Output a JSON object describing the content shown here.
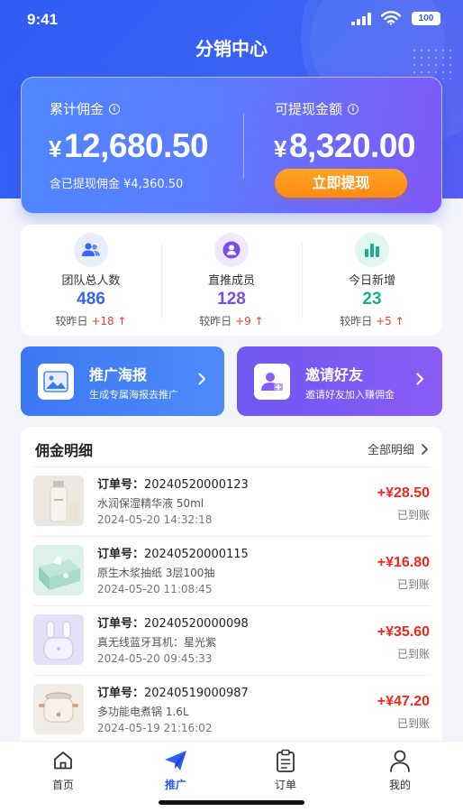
{
  "status_bar": {
    "time": "9:41",
    "battery": "100"
  },
  "page": {
    "title": "分销中心"
  },
  "commission": {
    "total_label": "累计佣金",
    "total_amount": "12,680.50",
    "currency": "¥",
    "withdrawn_text": "含已提现佣金 ¥4,360.50",
    "available_label": "可提现金额",
    "available_amount": "8,320.00",
    "withdraw_button": "立即提现"
  },
  "stats": [
    {
      "label": "团队总人数",
      "value": "486",
      "compare_label": "较昨日",
      "delta": "+18",
      "color": "#3a63f5"
    },
    {
      "label": "直推成员",
      "value": "128",
      "compare_label": "较昨日",
      "delta": "+9",
      "color": "#7b4de8"
    },
    {
      "label": "今日新增",
      "value": "23",
      "compare_label": "较昨日",
      "delta": "+5",
      "color": "#1eae8e"
    }
  ],
  "promo": {
    "poster_title": "推广海报",
    "poster_desc": "生成专属海报去推广",
    "invite_title": "邀请好友",
    "invite_desc": "邀请好友加入赚佣金"
  },
  "details": {
    "title": "佣金明细",
    "view_all": "全部明细",
    "items": [
      {
        "order_label": "订单号：",
        "order_no": "20240520000123",
        "product": "水润保湿精华液 50ml",
        "time": "2024-05-20 14:32:18",
        "amount": "+¥28.50",
        "status": "已到账"
      },
      {
        "order_label": "订单号：",
        "order_no": "20240520000115",
        "product": "原生木浆抽纸 3层100抽",
        "time": "2024-05-20 11:08:45",
        "amount": "+¥16.80",
        "status": "已到账"
      },
      {
        "order_label": "订单号：",
        "order_no": "20240520000098",
        "product": "真无线蓝牙耳机：星光紫",
        "time": "2024-05-20 09:45:33",
        "amount": "+¥35.60",
        "status": "已到账"
      },
      {
        "order_label": "订单号：",
        "order_no": "20240519000987",
        "product": "多功能电煮锅 1.6L",
        "time": "2024-05-19 21:16:02",
        "amount": "+¥47.20",
        "status": "已到账"
      }
    ]
  },
  "tabs": [
    {
      "label": "首页"
    },
    {
      "label": "推广"
    },
    {
      "label": "订单"
    },
    {
      "label": "我的"
    }
  ],
  "colors": {
    "primary": "#2f5cf3",
    "accent_orange": "#ff8a12",
    "positive_red": "#f0261f"
  }
}
